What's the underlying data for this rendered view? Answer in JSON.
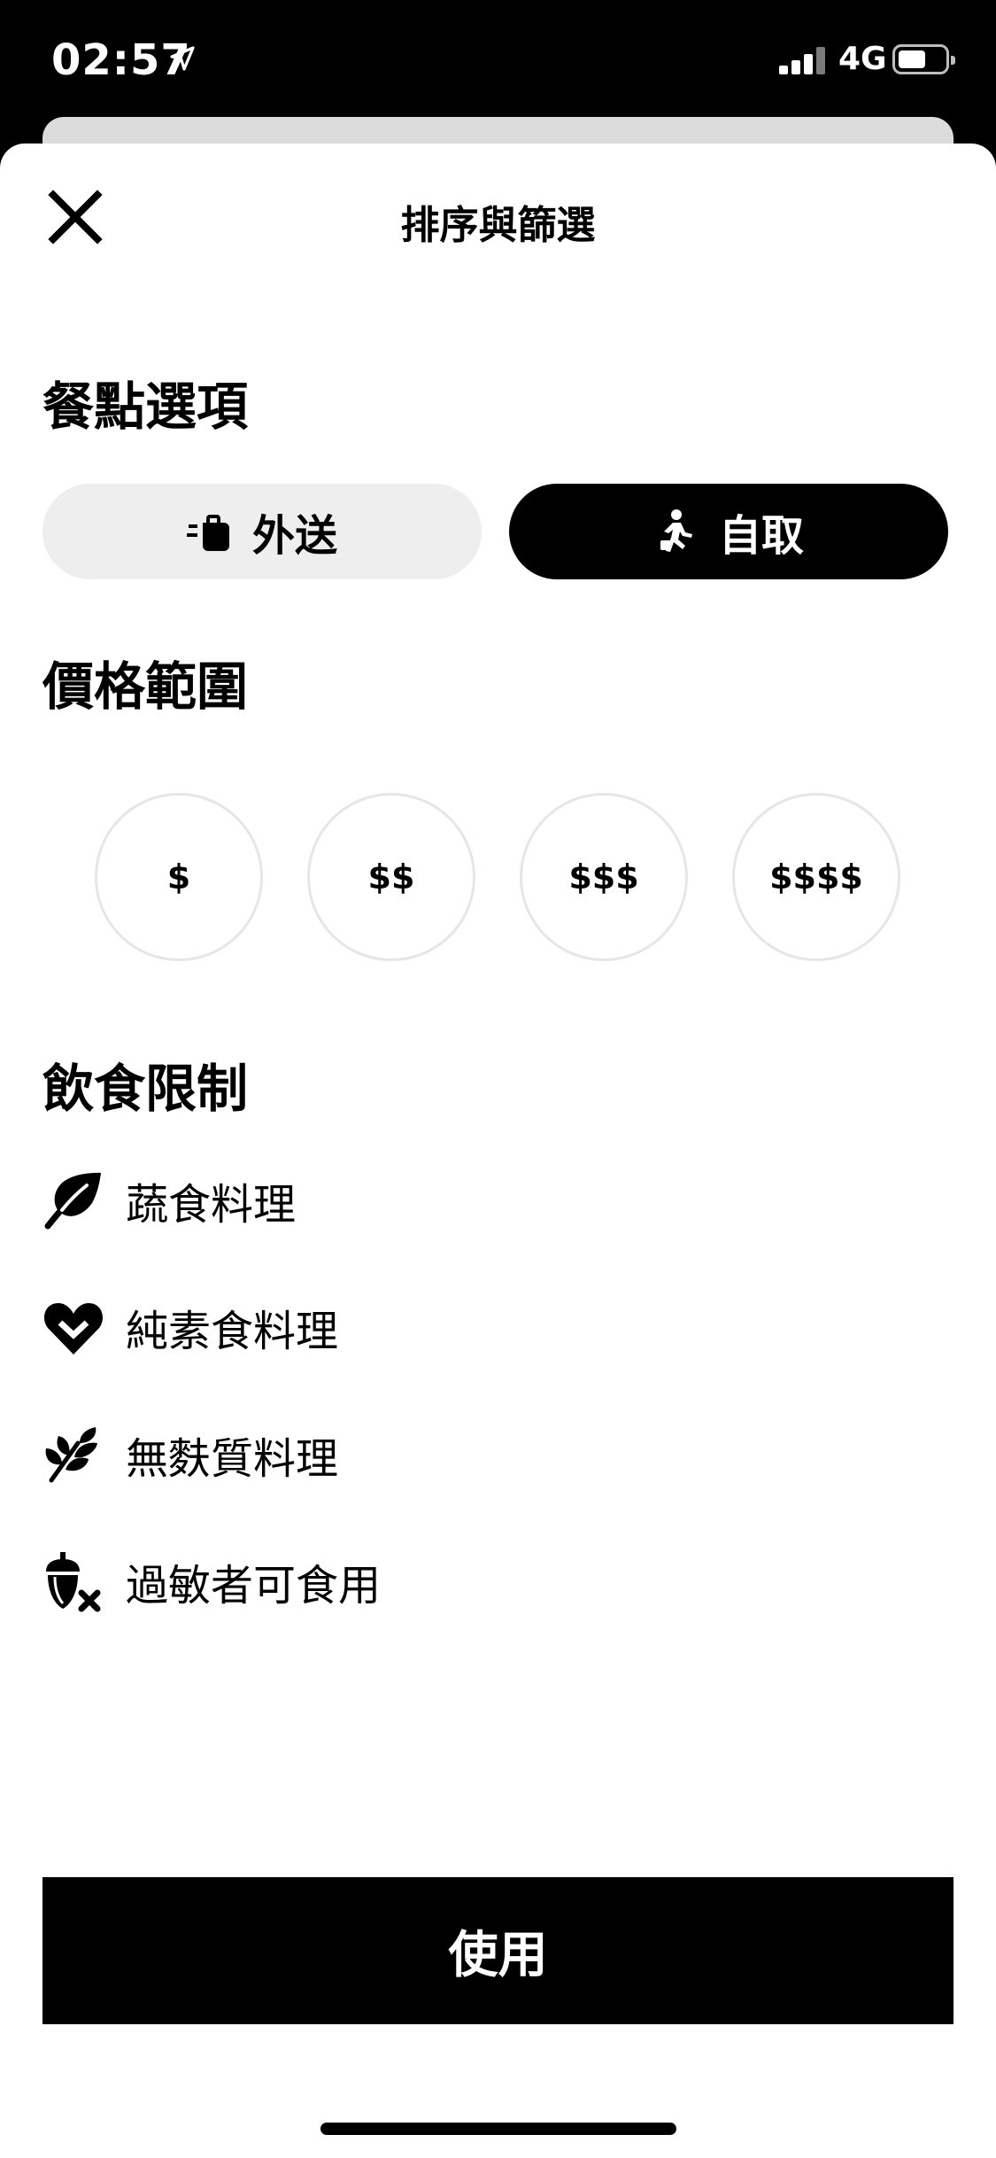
{
  "status_bar": {
    "time": "02:57",
    "network": "4G",
    "battery_level": 0.5,
    "signal_bars": 3
  },
  "header": {
    "title": "排序與篩選",
    "close_icon": "close-icon"
  },
  "meal_options": {
    "title": "餐點選項",
    "options": [
      {
        "label": "外送",
        "icon": "delivery-bag-icon",
        "selected": false
      },
      {
        "label": "自取",
        "icon": "pickup-walking-icon",
        "selected": true
      }
    ]
  },
  "price_range": {
    "title": "價格範圍",
    "options": [
      "$",
      "$$",
      "$$$",
      "$$$$"
    ]
  },
  "dietary": {
    "title": "飲食限制",
    "items": [
      {
        "label": "蔬食料理",
        "icon": "leaf-icon"
      },
      {
        "label": "純素食料理",
        "icon": "heart-check-icon"
      },
      {
        "label": "無麩質料理",
        "icon": "wheat-leaves-icon"
      },
      {
        "label": "過敏者可食用",
        "icon": "acorn-x-icon"
      }
    ]
  },
  "apply_label": "使用",
  "colors": {
    "primary": "#000000",
    "background": "#ffffff",
    "pill_inactive": "#eeeeee",
    "circle_border": "#e6e6e6"
  }
}
